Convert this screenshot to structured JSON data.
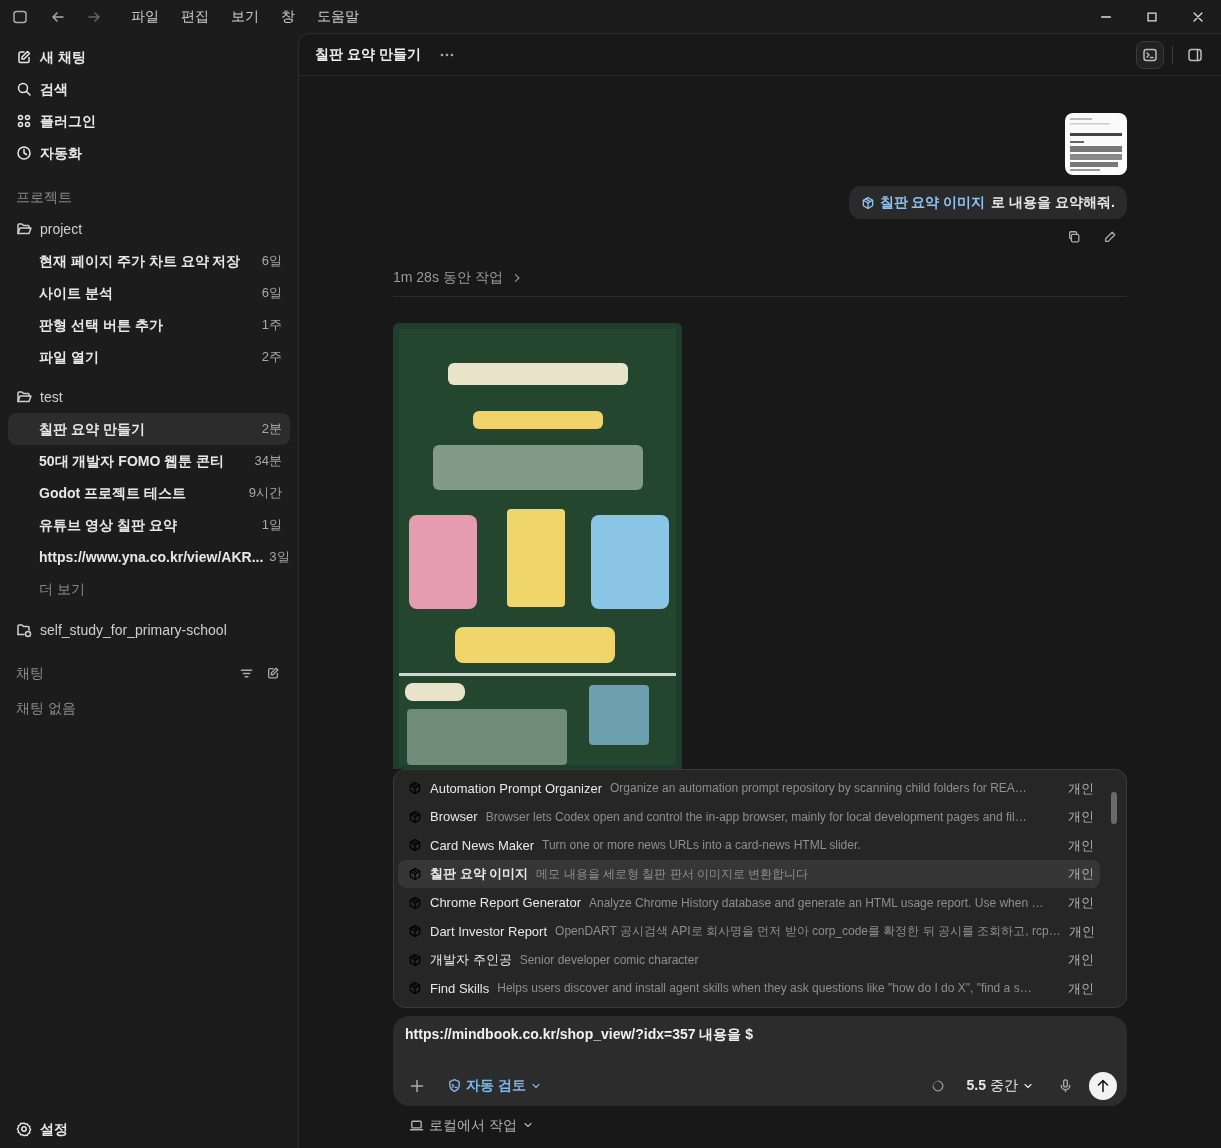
{
  "menu": [
    "파일",
    "편집",
    "보기",
    "창",
    "도움말"
  ],
  "sidebar": {
    "actions": [
      {
        "kind": "new",
        "label": "새 채팅"
      },
      {
        "kind": "search",
        "label": "검색"
      },
      {
        "kind": "plugins",
        "label": "플러그인"
      },
      {
        "kind": "automation",
        "label": "자동화"
      }
    ],
    "projects_heading": "프로젝트",
    "projects": [
      {
        "kind": "folder",
        "name": "project",
        "chats": [
          {
            "title": "현재 페이지 주가 차트 요약 저장",
            "age": "6일",
            "selected": false
          },
          {
            "title": "사이트 분석",
            "age": "6일",
            "selected": false
          },
          {
            "title": "판형 선택 버튼 추가",
            "age": "1주",
            "selected": false
          },
          {
            "title": "파일 열기",
            "age": "2주",
            "selected": false
          }
        ]
      },
      {
        "kind": "folder",
        "name": "test",
        "more": "더 보기",
        "chats": [
          {
            "title": "칠판 요약 만들기",
            "age": "2분",
            "selected": true
          },
          {
            "title": "50대 개발자 FOMO 웹툰 콘티",
            "age": "34분",
            "selected": false
          },
          {
            "title": "Godot 프로젝트 테스트",
            "age": "9시간",
            "selected": false
          },
          {
            "title": "유튜브 영상 칠판 요약",
            "age": "1일",
            "selected": false
          },
          {
            "title": "https://www.yna.co.kr/view/AKR...",
            "age": "3일",
            "selected": false
          }
        ]
      },
      {
        "kind": "remote-folder",
        "name": "self_study_for_primary-school"
      }
    ],
    "chats_heading": "채팅",
    "chats_empty": "채팅 없음",
    "settings": "설정"
  },
  "header": {
    "title": "칠판 요약 만들기"
  },
  "message": {
    "skill": "칠판 요약 이미지",
    "text": "로 내용을 요약해줘."
  },
  "work_summary": "1m 28s 동안 작업",
  "skills": [
    {
      "name": "Automation Prompt Organizer",
      "description": "Organize an automation prompt repository by scanning child folders for REA…",
      "scope": "개인",
      "selected": false
    },
    {
      "name": "Browser",
      "description": "Browser lets Codex open and control the in-app browser, mainly for local development pages and fil…",
      "scope": "개인",
      "selected": false
    },
    {
      "name": "Card News Maker",
      "description": "Turn one or more news URLs into a card-news HTML slider.",
      "scope": "개인",
      "selected": false
    },
    {
      "name": "칠판 요약 이미지",
      "description": "메모 내용을 세로형 칠판 판서 이미지로 변환합니다",
      "scope": "개인",
      "selected": true
    },
    {
      "name": "Chrome Report Generator",
      "description": "Analyze Chrome History database and generate an HTML usage report. Use when …",
      "scope": "개인",
      "selected": false
    },
    {
      "name": "Dart Investor Report",
      "description": "OpenDART 공시검색 API로 회사명을 먼저 받아 corp_code를 확정한 뒤 공시를 조회하고, rcp…",
      "scope": "개인",
      "selected": false
    },
    {
      "name": "개발자 주인공",
      "description": "Senior developer comic character",
      "scope": "개인",
      "selected": false
    },
    {
      "name": "Find Skills",
      "description": "Helps users discover and install agent skills when they ask questions like \"how do I do X\", \"find a s…",
      "scope": "개인",
      "selected": false
    }
  ],
  "composer": {
    "value": "https://mindbook.co.kr/shop_view/?idx=357 내용을 $",
    "review": "자동 검토",
    "model": "5.5",
    "effort": "중간"
  },
  "footer": {
    "location": "로컬에서 작업"
  }
}
